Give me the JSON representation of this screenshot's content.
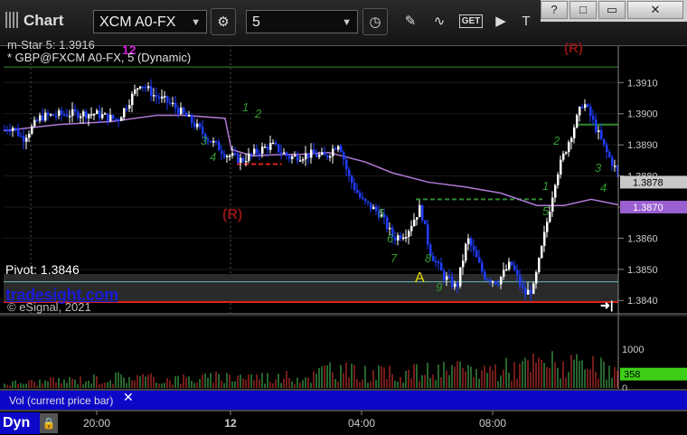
{
  "window": {
    "title": "Chart"
  },
  "toolbar": {
    "symbol": "XCM A0-FX",
    "interval": "5",
    "tools": [
      "gear-icon",
      "clock-icon",
      "pencil-icon",
      "indicator-icon",
      "get-icon",
      "play-icon",
      "text-tool-icon"
    ],
    "get_label": "GET",
    "window_buttons": [
      "?",
      "□",
      "▭",
      "✕"
    ]
  },
  "header": {
    "study_label": "m-Star 5: 1.3916",
    "study_badge": "12",
    "symbol_line": "* GBP@FXCM A0-FX, 5 (Dynamic)"
  },
  "annotations": {
    "pivot": "Pivot: 1.3846",
    "tradesight": "tradesight.com",
    "copyright": "© eSignal, 2021",
    "r_label_left": "(R)",
    "r_label_top": "(R)",
    "a_label": "A",
    "vol_label": "Vol (current price bar)",
    "bottom_label": "Dyn"
  },
  "colors": {
    "up": "#ffffff",
    "down": "#1f3dff",
    "ma": "#b07ad8",
    "vol_up": "#3fa84a",
    "vol_down": "#c0302a",
    "last_price_bg": "#c8c8c8",
    "ma_price_bg": "#9a5fd0",
    "vol_badge": "#3dd017",
    "pivot_line": "#66bbbb",
    "support_line": "#e0201b",
    "resistance_line": "#2f8a2f"
  },
  "chart_data": {
    "type": "candlestick",
    "price_axis": {
      "ticks": [
        1.391,
        1.39,
        1.389,
        1.388,
        1.387,
        1.386,
        1.385,
        1.384
      ],
      "tick_labels": [
        "1.3910",
        "1.3900",
        "1.3890",
        "1.3880",
        "1.3870",
        "1.3860",
        "1.3850",
        "1.3840"
      ],
      "range": [
        1.3836,
        1.3922
      ]
    },
    "time_axis": {
      "labels": [
        "20:00",
        "12",
        "04:00",
        "08:00"
      ]
    },
    "last_price": "1.3878",
    "ma_price": "1.3870",
    "volume_axis": {
      "ticks": [
        0,
        1000
      ],
      "range": [
        0,
        1800
      ]
    },
    "last_volume": "358",
    "levels": {
      "pivot": 1.3846,
      "support": 1.38395,
      "top": 1.3915,
      "green_mid": 1.38725,
      "green_right": 1.38965,
      "red_dash": 1.38838
    },
    "anchors": [
      [
        0,
        1.3895
      ],
      [
        8,
        1.3896
      ],
      [
        20,
        1.3892
      ],
      [
        40,
        1.3899
      ],
      [
        70,
        1.39
      ],
      [
        100,
        1.39
      ],
      [
        125,
        1.3898
      ],
      [
        150,
        1.391
      ],
      [
        165,
        1.3906
      ],
      [
        185,
        1.3903
      ],
      [
        205,
        1.3898
      ],
      [
        225,
        1.3892
      ],
      [
        245,
        1.3887
      ],
      [
        262,
        1.3885
      ],
      [
        280,
        1.3888
      ],
      [
        295,
        1.389
      ],
      [
        315,
        1.3886
      ],
      [
        340,
        1.3887
      ],
      [
        355,
        1.3886
      ],
      [
        370,
        1.3891
      ],
      [
        380,
        1.388
      ],
      [
        395,
        1.3872
      ],
      [
        415,
        1.3868
      ],
      [
        430,
        1.386
      ],
      [
        445,
        1.3862
      ],
      [
        460,
        1.387
      ],
      [
        470,
        1.3856
      ],
      [
        485,
        1.3848
      ],
      [
        500,
        1.3844
      ],
      [
        512,
        1.386
      ],
      [
        530,
        1.3848
      ],
      [
        545,
        1.3846
      ],
      [
        560,
        1.3852
      ],
      [
        575,
        1.3842
      ],
      [
        585,
        1.3844
      ],
      [
        595,
        1.3858
      ],
      [
        610,
        1.388
      ],
      [
        625,
        1.3892
      ],
      [
        640,
        1.3904
      ],
      [
        650,
        1.3898
      ],
      [
        665,
        1.3888
      ],
      [
        680,
        1.388
      ]
    ],
    "ma_points": [
      [
        0,
        1.38945
      ],
      [
        60,
        1.38965
      ],
      [
        120,
        1.38975
      ],
      [
        170,
        1.38995
      ],
      [
        200,
        1.38995
      ],
      [
        245,
        1.38985
      ],
      [
        252,
        1.38885
      ],
      [
        275,
        1.38865
      ],
      [
        300,
        1.38868
      ],
      [
        330,
        1.3887
      ],
      [
        360,
        1.38875
      ],
      [
        400,
        1.38845
      ],
      [
        430,
        1.3881
      ],
      [
        470,
        1.3878
      ],
      [
        510,
        1.38765
      ],
      [
        550,
        1.38745
      ],
      [
        590,
        1.38705
      ],
      [
        620,
        1.38705
      ],
      [
        650,
        1.38725
      ],
      [
        684,
        1.38705
      ]
    ],
    "volume_profile": [
      [
        0,
        120
      ],
      [
        60,
        180
      ],
      [
        120,
        260
      ],
      [
        140,
        300
      ],
      [
        170,
        220
      ],
      [
        230,
        250
      ],
      [
        260,
        320
      ],
      [
        300,
        260
      ],
      [
        340,
        300
      ],
      [
        360,
        520
      ],
      [
        380,
        400
      ],
      [
        420,
        350
      ],
      [
        470,
        420
      ],
      [
        500,
        430
      ],
      [
        540,
        480
      ],
      [
        570,
        520
      ],
      [
        600,
        650
      ],
      [
        630,
        540
      ],
      [
        660,
        480
      ],
      [
        684,
        358
      ]
    ]
  }
}
